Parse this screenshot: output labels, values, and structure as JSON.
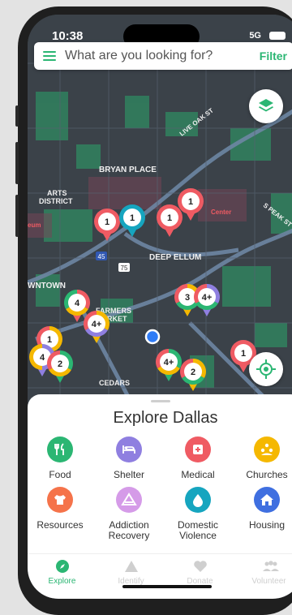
{
  "status": {
    "time": "10:38",
    "network": "5G"
  },
  "search": {
    "placeholder": "What are you looking for?",
    "filter_label": "Filter"
  },
  "map": {
    "labels": [
      "BRYAN PLACE",
      "ARTS",
      "DISTRICT",
      "DEEP ELLUM",
      "WNTOWN",
      "FARMERS",
      "MARKET",
      "CEDARS",
      "LIVE OAK ST",
      "S PEAK ST",
      "Center",
      "eum",
      "45",
      "75"
    ],
    "pins": [
      "1",
      "1",
      "1",
      "1",
      "4",
      "4+",
      "3",
      "4+",
      "1",
      "4",
      "2",
      "4+",
      "2",
      "1"
    ]
  },
  "sheet": {
    "title": "Explore Dallas",
    "categories": [
      {
        "label": "Food",
        "color": "#2bb673"
      },
      {
        "label": "Shelter",
        "color": "#8f7fe0"
      },
      {
        "label": "Medical",
        "color": "#ef5b63"
      },
      {
        "label": "Churches",
        "color": "#f5b800"
      },
      {
        "label": "Resources",
        "color": "#f5734a"
      },
      {
        "label": "Addiction Recovery",
        "color": "#d59be8"
      },
      {
        "label": "Domestic Violence",
        "color": "#16a5bf"
      },
      {
        "label": "Housing",
        "color": "#3f6fe0"
      }
    ]
  },
  "tabs": [
    {
      "label": "Explore",
      "active": true
    },
    {
      "label": "Identify",
      "active": false
    },
    {
      "label": "Donate",
      "active": false
    },
    {
      "label": "Volunteer",
      "active": false
    }
  ],
  "colors": {
    "accent": "#2bb673",
    "inactive": "#cfcfcf"
  }
}
